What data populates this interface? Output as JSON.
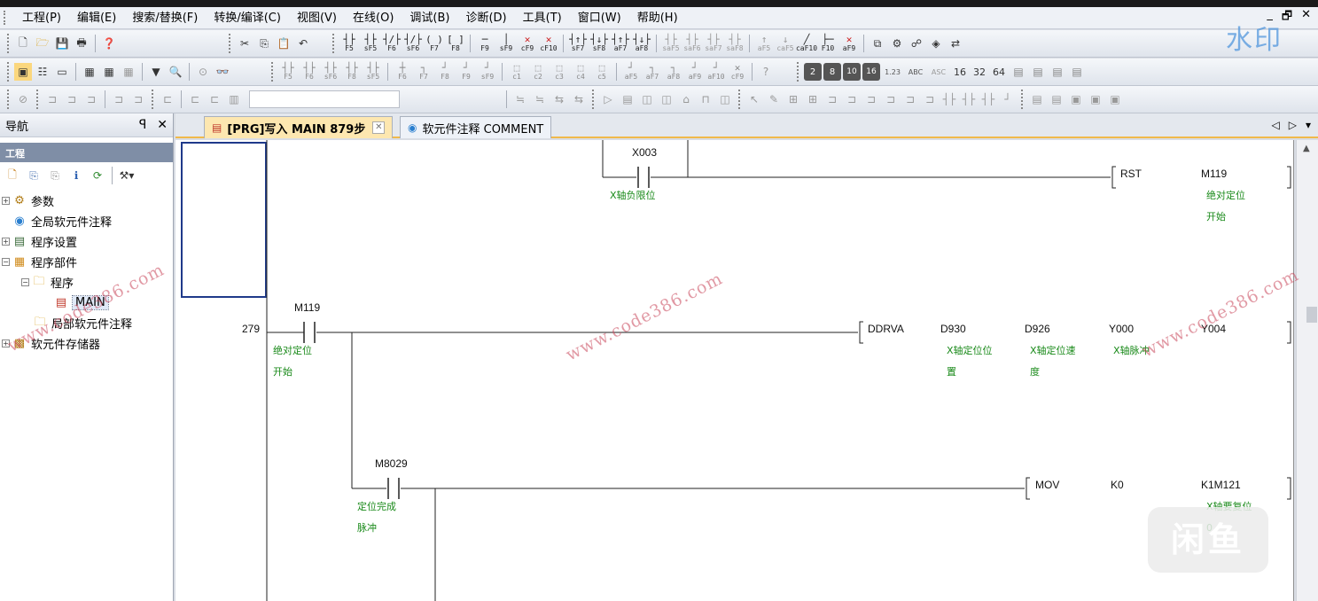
{
  "menubar": {
    "items": [
      "工程(P)",
      "编辑(E)",
      "搜索/替换(F)",
      "转换/编译(C)",
      "视图(V)",
      "在线(O)",
      "调试(B)",
      "诊断(D)",
      "工具(T)",
      "窗口(W)",
      "帮助(H)"
    ],
    "window_controls": [
      "_",
      "🗗",
      "✕"
    ]
  },
  "toolbar1": {
    "ladder_keys": [
      "F5",
      "sF5",
      "F6",
      "sF6",
      "F7",
      "F8",
      "F9",
      "sF9",
      "cF9",
      "cF10",
      "sF7",
      "sF8",
      "aF7",
      "aF8",
      "saF5",
      "saF6",
      "saF7",
      "saF8",
      "aF5",
      "caF5",
      "caF10",
      "F10",
      "aF9"
    ]
  },
  "toolbar2": {
    "ladder_keys": [
      "F5",
      "F6",
      "sF6",
      "F8",
      "sF5",
      "F6",
      "F7",
      "F8",
      "F9",
      "sF9",
      "c1",
      "c2",
      "c3",
      "c4",
      "c5",
      "aF5",
      "aF7",
      "aF8",
      "aF9",
      "aF10",
      "cF9"
    ],
    "number_buttons": [
      "2",
      "8",
      "10",
      "16",
      "1.23",
      "ABC",
      "ASC",
      "16",
      "32",
      "64"
    ]
  },
  "watermark_top": "水印",
  "watermark_text": "www.code386.com",
  "watermark_logo": "闲鱼",
  "nav": {
    "title": "导航",
    "pin": "ꟼ",
    "close": "✕",
    "project_header": "工程",
    "tree": [
      {
        "label": "参数",
        "expander": "+",
        "indent": 0
      },
      {
        "label": "全局软元件注释",
        "expander": "",
        "indent": 0
      },
      {
        "label": "程序设置",
        "expander": "+",
        "indent": 0
      },
      {
        "label": "程序部件",
        "expander": "−",
        "indent": 0
      },
      {
        "label": "程序",
        "expander": "−",
        "indent": 1
      },
      {
        "label": "MAIN",
        "expander": "",
        "indent": 2
      },
      {
        "label": "局部软元件注释",
        "expander": "",
        "indent": 1
      },
      {
        "label": "软元件存储器",
        "expander": "+",
        "indent": 0
      }
    ]
  },
  "tabs": [
    {
      "label": "[PRG]写入 MAIN 879步",
      "active": true
    },
    {
      "label": "软元件注释 COMMENT",
      "active": false
    }
  ],
  "tab_nav": [
    "◁",
    "▷",
    "▾"
  ],
  "ladder": {
    "rung1": {
      "contact": "X003",
      "contact_comment": "X轴负限位",
      "instruction": "RST",
      "operand": "M119",
      "operand_comment": [
        "绝对定位",
        "开始"
      ]
    },
    "rung2": {
      "step": "279",
      "contact": "M119",
      "contact_comment": [
        "绝对定位",
        "开始"
      ],
      "instruction": "DDRVA",
      "operands": [
        {
          "name": "D930",
          "comment": [
            "X轴定位位",
            "置"
          ]
        },
        {
          "name": "D926",
          "comment": [
            "X轴定位速",
            "度"
          ]
        },
        {
          "name": "Y000",
          "comment": [
            "X轴脉冲"
          ]
        },
        {
          "name": "Y004",
          "comment": []
        }
      ]
    },
    "rung3": {
      "contact": "M8029",
      "contact_comment": [
        "定位完成",
        "脉冲"
      ],
      "instruction": "MOV",
      "operands": [
        {
          "name": "K0",
          "comment": []
        },
        {
          "name": "K1M121",
          "comment": [
            "X轴要复位",
            "0"
          ]
        }
      ]
    }
  }
}
